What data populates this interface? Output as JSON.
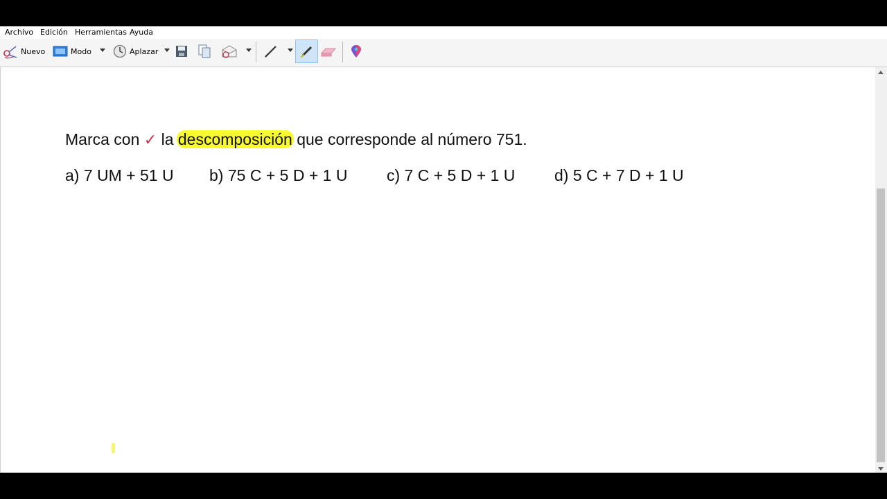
{
  "menu": [
    "Archivo",
    "Edición",
    "Herramientas",
    "Ayuda"
  ],
  "toolbar": {
    "nuevo": "Nuevo",
    "modo": "Modo",
    "aplazar": "Aplazar",
    "icons": {
      "nuevo": "scissors-pen-icon",
      "modo": "screen-mode-icon",
      "aplazar": "clock-icon",
      "guardar": "save-icon",
      "copiar": "copy-icon",
      "enviar": "send-mail-icon",
      "pluma": "pen-icon",
      "resaltador": "highlighter-icon",
      "borrador": "eraser-icon",
      "color": "color-pin-icon"
    }
  },
  "content": {
    "question": {
      "before": "Marca con",
      "check": "✓",
      "mid": "la",
      "highlighted": "descomposición",
      "after": "que corresponde al número 751."
    },
    "options": [
      "a) 7 UM + 51 U",
      "b) 75 C + 5 D + 1 U",
      "c) 7 C + 5 D + 1 U",
      "d) 5 C + 7 D + 1 U"
    ]
  },
  "colors": {
    "highlight": "#f9f92f",
    "check": "#d0304a",
    "active_tool": "#cfe4f7"
  }
}
